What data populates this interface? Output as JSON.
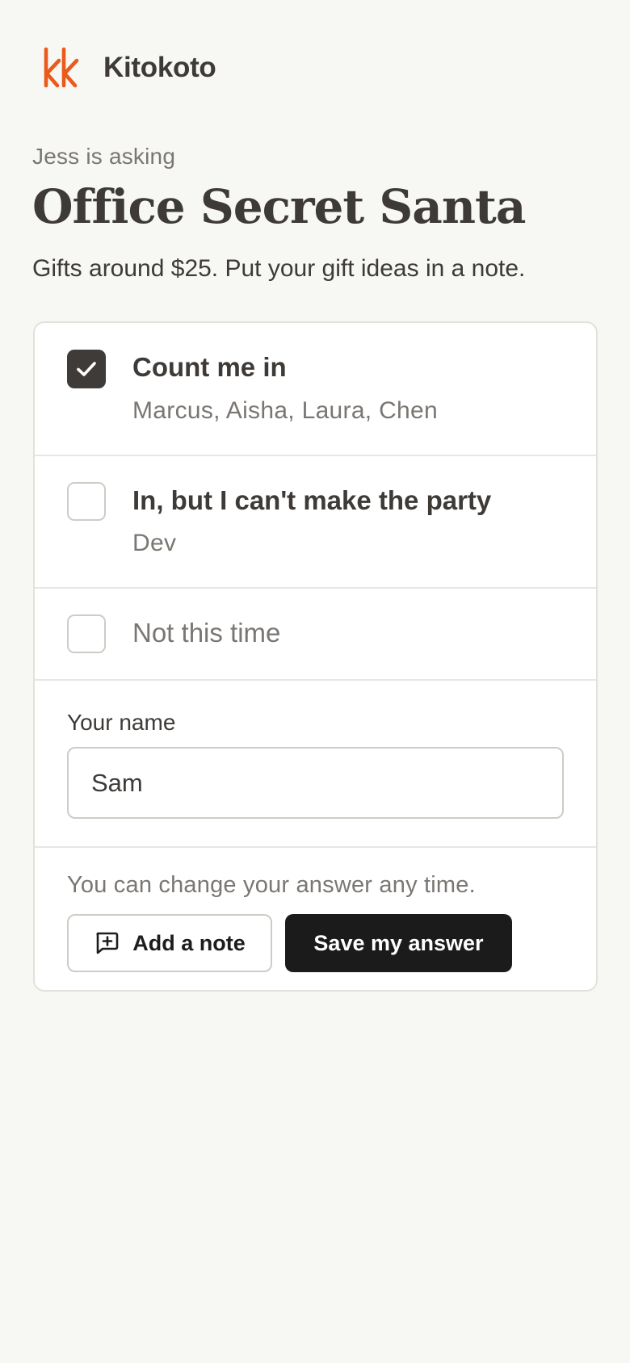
{
  "brand": {
    "name": "Kitokoto",
    "logo_icon": "kk-logo-icon",
    "accent_color": "#ea5a1a"
  },
  "poll": {
    "asker": "Jess is asking",
    "title": "Office Secret Santa",
    "description": "Gifts around $25. Put your gift ideas in a note."
  },
  "options": [
    {
      "label": "Count me in",
      "voters": "Marcus, Aisha, Laura, Chen",
      "checked": true
    },
    {
      "label": "In, but I can't make the party",
      "voters": "Dev",
      "checked": false
    },
    {
      "label": "Not this time",
      "voters": "",
      "checked": false
    }
  ],
  "name_field": {
    "label": "Your name",
    "value": "Sam"
  },
  "footer": {
    "hint": "You can change your answer any time.",
    "add_note_label": "Add a note",
    "add_note_icon": "message-plus-icon",
    "save_label": "Save my answer"
  },
  "colors": {
    "background": "#f7f7f4",
    "text": "#3d3a37",
    "muted": "#7a7672",
    "primary_button": "#1b1b1c",
    "checked_box": "#3f3b38"
  }
}
